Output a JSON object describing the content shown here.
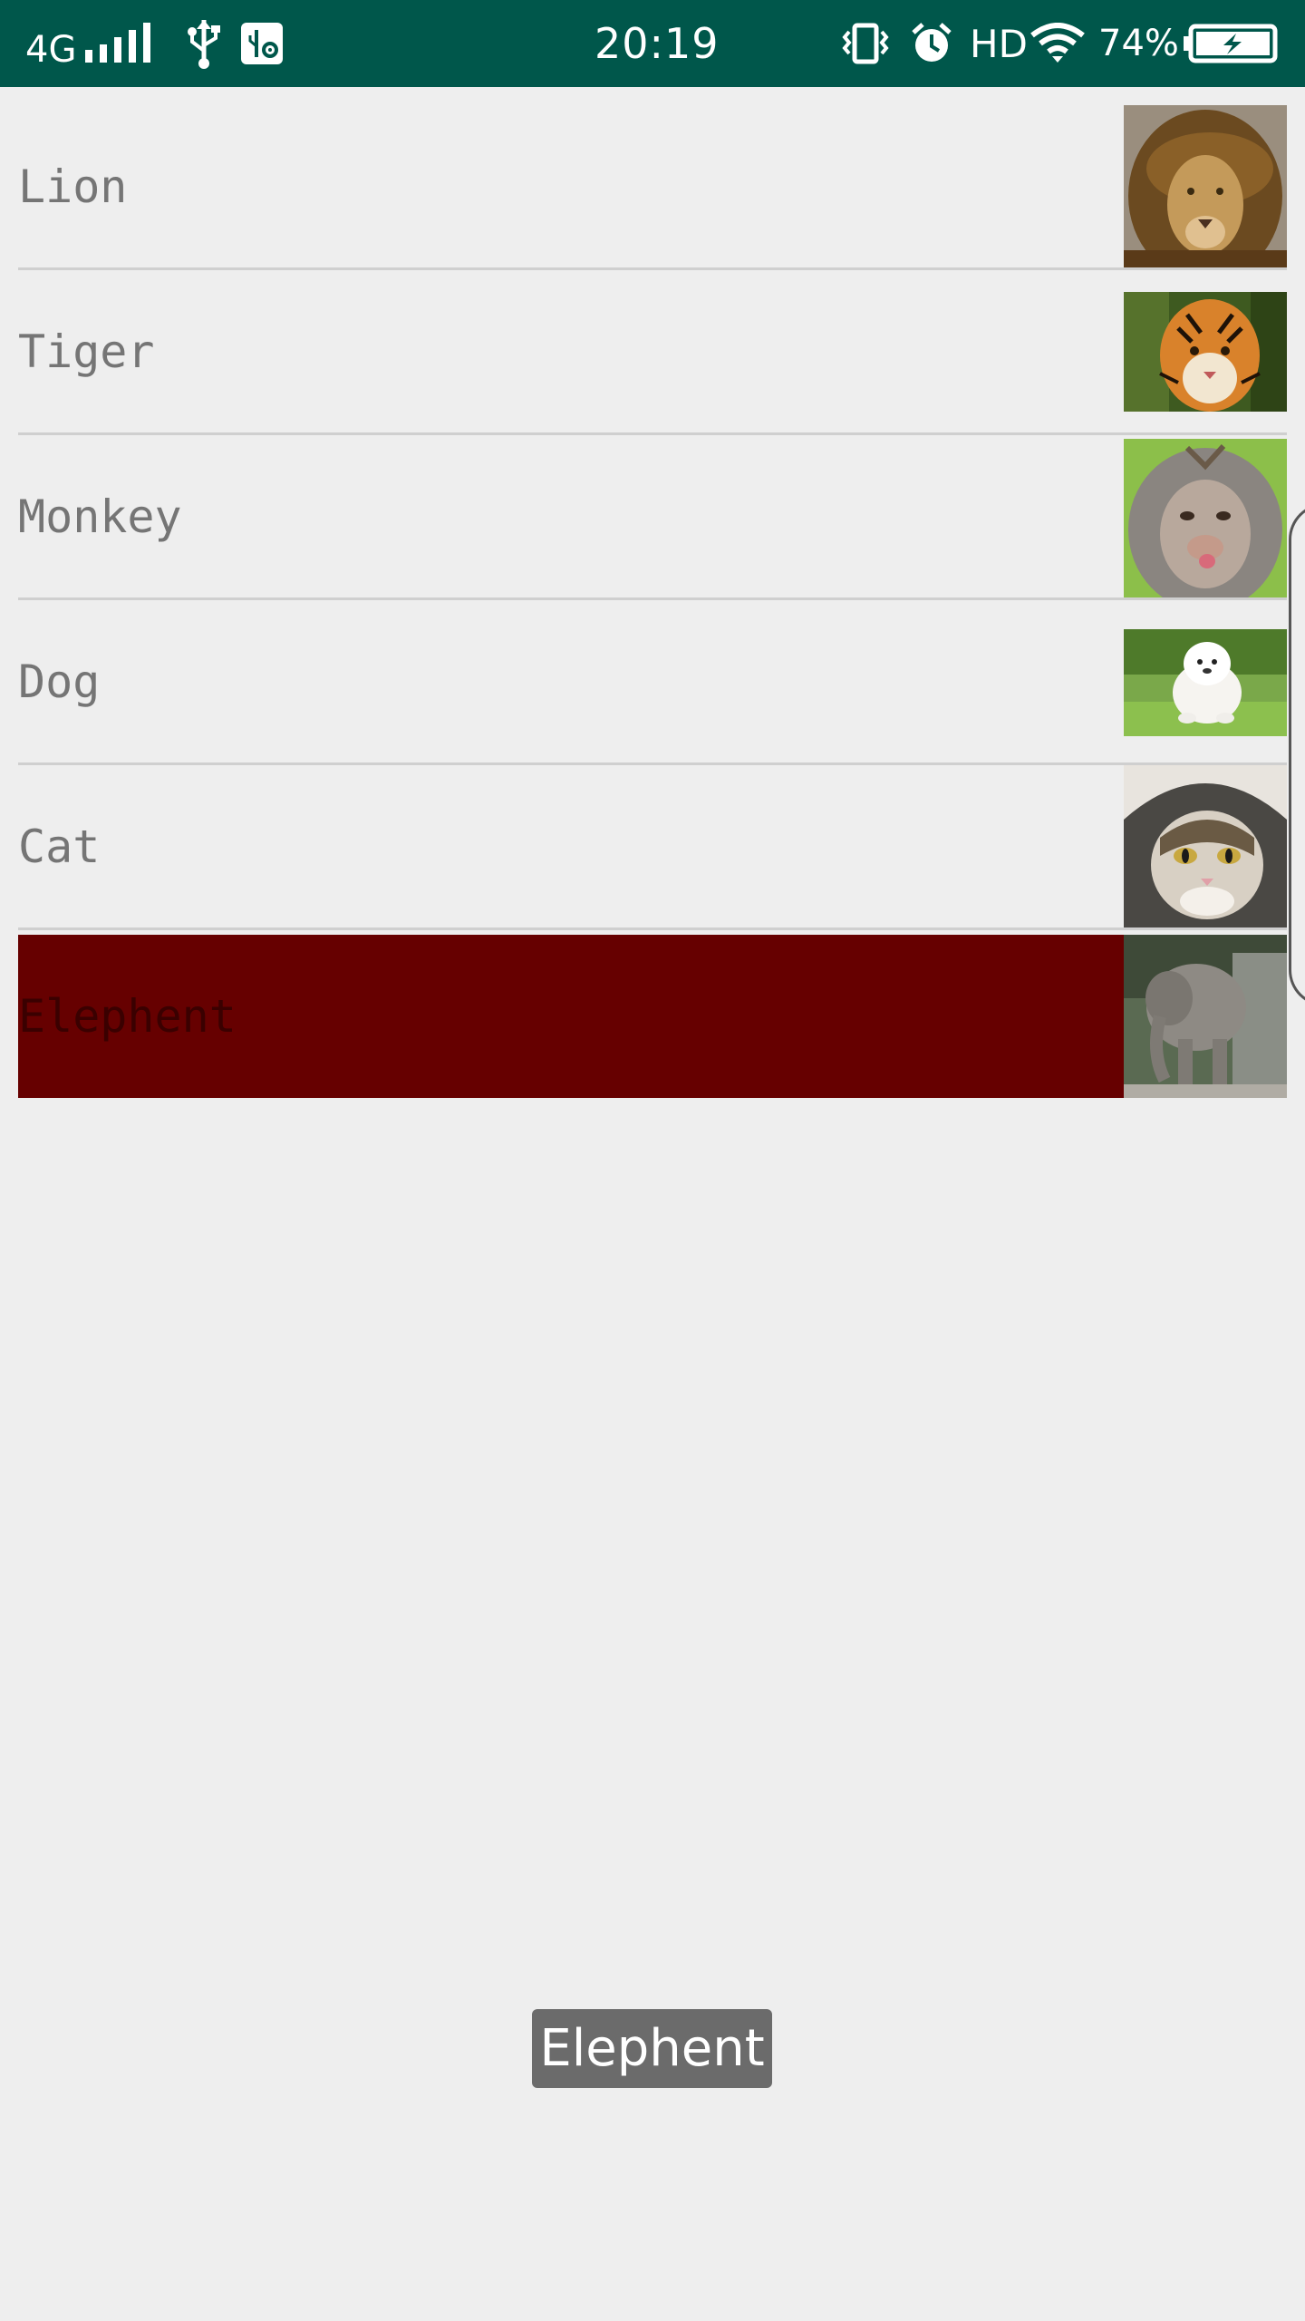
{
  "status_bar": {
    "network": "4G",
    "time": "20:19",
    "hd": "HD",
    "battery_percent": "74%",
    "icons": [
      "signal-icon",
      "usb-icon",
      "usb-debug-icon",
      "vibrate-icon",
      "alarm-icon",
      "wifi-icon",
      "battery-charging-icon"
    ],
    "background_color": "#00574b"
  },
  "animal_list": {
    "items": [
      {
        "label": "Lion",
        "image": "lion-photo"
      },
      {
        "label": "Tiger",
        "image": "tiger-photo"
      },
      {
        "label": "Monkey",
        "image": "monkey-photo"
      },
      {
        "label": "Dog",
        "image": "dog-photo"
      },
      {
        "label": "Cat",
        "image": "cat-photo"
      },
      {
        "label": "Elephent",
        "image": "elephant-photo",
        "selected": true
      }
    ],
    "selected_color": "#660000"
  },
  "toast": {
    "text": "Elephent"
  }
}
